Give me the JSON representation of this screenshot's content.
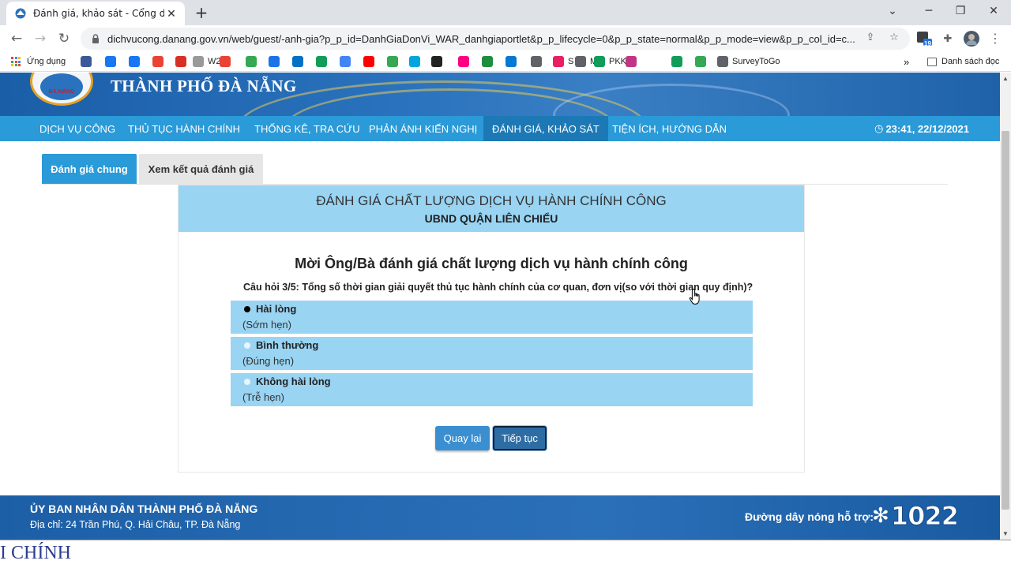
{
  "browser": {
    "tab_title": "Đánh giá, khảo sát - Cổng dịch vụ công",
    "tab_close": "✕",
    "new_tab": "+",
    "window_controls": [
      "⌄",
      "─",
      "❐",
      "✕"
    ],
    "back": "←",
    "forward": "→",
    "reload": "↻",
    "url": "dichvucong.danang.gov.vn/web/guest/-anh-gia?p_p_id=DanhGiaDonVi_WAR_danhgiaportlet&p_p_lifecycle=0&p_p_state=normal&p_p_mode=view&p_p_col_id=c...",
    "ext_badge": "19",
    "bookmarks": [
      {
        "label": "Ứng dụng",
        "color": "#4285f4"
      },
      {
        "label": "",
        "color": "#3b5998"
      },
      {
        "label": "",
        "color": "#1877f2"
      },
      {
        "label": "",
        "color": "#1877f2"
      },
      {
        "label": "",
        "color": "#ea4335"
      },
      {
        "label": "",
        "color": "#d93025"
      },
      {
        "label": "W2J",
        "color": "#999999"
      },
      {
        "label": "",
        "color": "#ea4335"
      },
      {
        "label": "",
        "color": "#34a853"
      },
      {
        "label": "",
        "color": "#1a73e8"
      },
      {
        "label": "",
        "color": "#0072c6"
      },
      {
        "label": "",
        "color": "#0f9d58"
      },
      {
        "label": "",
        "color": "#4285f4"
      },
      {
        "label": "",
        "color": "#ff0000"
      },
      {
        "label": "",
        "color": "#34a853"
      },
      {
        "label": "",
        "color": "#00a5e0"
      },
      {
        "label": "",
        "color": "#222222"
      },
      {
        "label": "",
        "color": "#ff0084"
      },
      {
        "label": "",
        "color": "#1e8e3e"
      },
      {
        "label": "",
        "color": "#0078d4"
      },
      {
        "label": "",
        "color": "#5f6368"
      },
      {
        "label": "S",
        "color": "#e91e63"
      },
      {
        "label": "M",
        "color": "#5f6368"
      },
      {
        "label": "PKK",
        "color": "#0f9d58"
      },
      {
        "label": "",
        "color": "#c13584"
      },
      {
        "label": "",
        "color": "#0f9d58"
      },
      {
        "label": "",
        "color": "#34a853"
      },
      {
        "label": "SurveyToGo",
        "color": "#5f6368"
      }
    ],
    "bookmarks_more": "»",
    "reading_list": "Danh sách đọc"
  },
  "site": {
    "city_name": "THÀNH PHỐ ĐÀ NẴNG",
    "logo_text": "ĐÀ NẴNG",
    "menu": [
      {
        "label": "Dịch vụ công",
        "active": false
      },
      {
        "label": "Thủ tục hành chính",
        "active": false
      },
      {
        "label": "Thống kê, tra cứu",
        "active": false
      },
      {
        "label": "Phản ánh kiến nghị",
        "active": false
      },
      {
        "label": "Đánh giá, khảo sát",
        "active": true
      },
      {
        "label": "Tiện ích, hướng dẫn",
        "active": false
      }
    ],
    "clock_icon": "◷",
    "clock": "23:41, 22/12/2021"
  },
  "page_tabs": [
    "Đánh giá chung",
    "Xem kết quả đánh giá"
  ],
  "survey": {
    "title": "Đánh giá chất lượng dịch vụ hành chính công",
    "subtitle": "UBND QUẬN LIÊN CHIỂU",
    "invite": "Mời Ông/Bà đánh giá chất lượng dịch vụ hành chính công",
    "question": "Câu hỏi 3/5: Tổng số thời gian giải quyết thủ tục hành chính của cơ quan, đơn vị(so với thời gian quy định)?",
    "options": [
      {
        "label": "Hài lòng",
        "desc": "(Sớm hẹn)",
        "selected": true
      },
      {
        "label": "Bình thường",
        "desc": "(Đúng hẹn)",
        "selected": false
      },
      {
        "label": "Không hài lòng",
        "desc": "(Trễ hẹn)",
        "selected": false
      }
    ],
    "back_button": "Quay lại",
    "next_button": "Tiếp tục"
  },
  "footer": {
    "org": "ỦY BAN NHÂN DÂN THÀNH PHỐ ĐÀ NẴNG",
    "address": "Địa chỉ: 24 Trần Phú, Q. Hải Châu, TP. Đà Nẵng",
    "hotline_label": "Đường dây nóng hỗ trợ:",
    "hotline_star": "✻",
    "hotline_number": "1022"
  },
  "bottom_overlay": "I CHÍNH",
  "colors": {
    "menu_bar": "#2a9ad8",
    "menu_active": "#1c79b5",
    "option_bg": "#99d4f3",
    "button_back": "#3b8fd1",
    "button_next": "#2e6da4",
    "footer": "#1d5fa6"
  }
}
